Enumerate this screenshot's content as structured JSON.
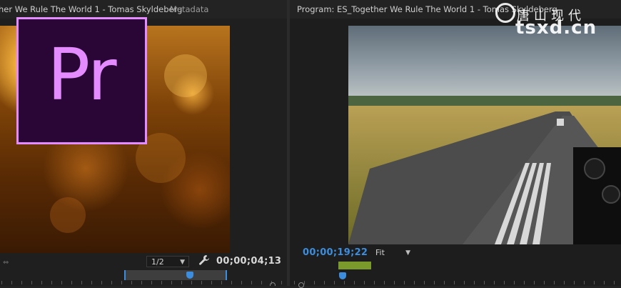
{
  "source_monitor": {
    "tab_title": "her We Rule The World 1 - Tomas Skyldeberg",
    "metadata_tab": "Metadata",
    "zoom_select": "1/2",
    "timecode": "00;00;04;13"
  },
  "program_monitor": {
    "tab_title": "Program: ES_Together We Rule The World 1 - Tomas Skyldeberg",
    "fit_select": "Fit",
    "timecode": "00;00;19;22"
  },
  "logo": {
    "text": "Pr"
  },
  "watermark": {
    "chinese": "唐山现代",
    "site": "tsxd.cn"
  },
  "colors": {
    "accent_blue": "#3c8dde",
    "logo_border": "#e48cff",
    "logo_bg": "#2a0637",
    "work_area_green": "#7a9a2c"
  },
  "icons": [
    "wrench-icon",
    "chevron-down-icon",
    "playhead-icon",
    "arrows-icon"
  ]
}
